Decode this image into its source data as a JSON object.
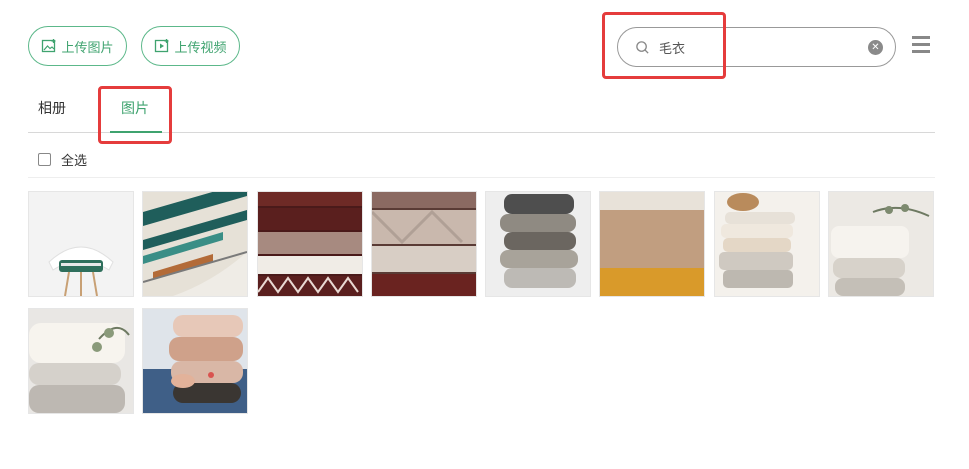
{
  "toolbar": {
    "upload_image_label": "上传图片",
    "upload_video_label": "上传视频"
  },
  "search": {
    "value": "毛衣"
  },
  "tabs": [
    {
      "label": "相册",
      "active": false
    },
    {
      "label": "图片",
      "active": true
    }
  ],
  "select_all_label": "全选",
  "accent_color": "#3fa36f",
  "highlight_color": "#e53c3c",
  "images": [
    {
      "subject": "white chair with folded sweater"
    },
    {
      "subject": "patterned knit sweater"
    },
    {
      "subject": "stacked dark red patterned sweaters"
    },
    {
      "subject": "stacked cable-knit sweaters"
    },
    {
      "subject": "stack of grey knit sweaters"
    },
    {
      "subject": "beige and mustard folded sweaters"
    },
    {
      "subject": "cream sweaters with accessories"
    },
    {
      "subject": "cream sweaters with eucalyptus"
    },
    {
      "subject": "white sweaters with eucalyptus"
    },
    {
      "subject": "person holding folded sweaters"
    }
  ]
}
